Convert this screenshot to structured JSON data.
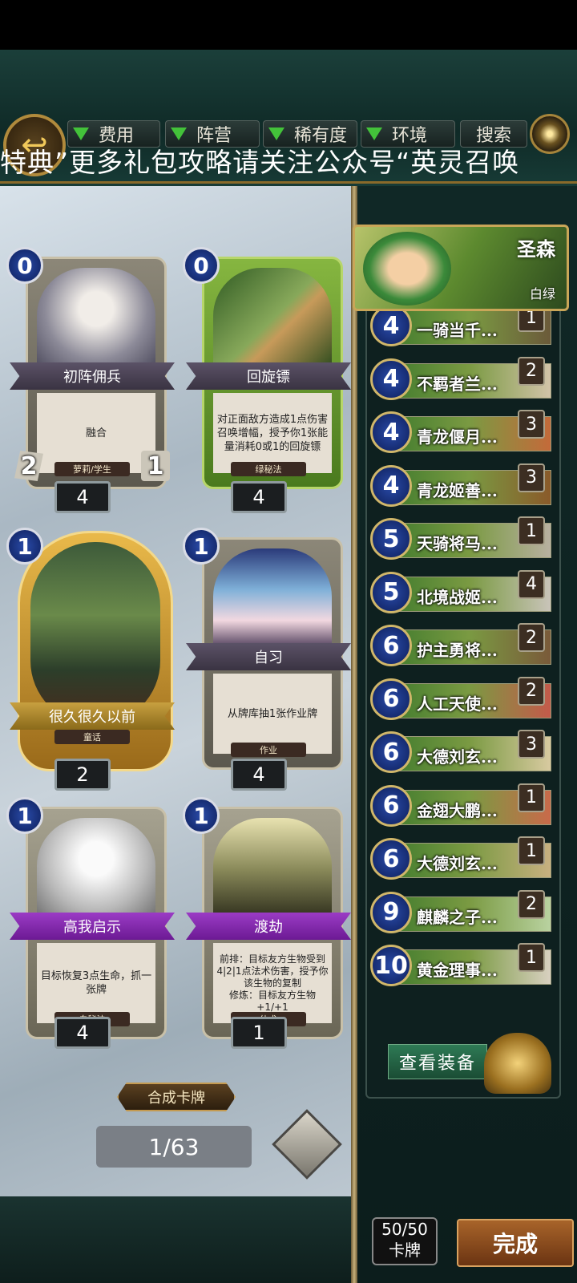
{
  "header": {
    "filters": [
      {
        "label": "费用"
      },
      {
        "label": "阵营"
      },
      {
        "label": "稀有度"
      },
      {
        "label": "环境"
      }
    ],
    "search_label": "搜索",
    "marquee": "特典”更多礼包攻略请关注公众号“英灵召唤"
  },
  "cards": [
    {
      "cost": "0",
      "name": "初阵佣兵",
      "text": "融合",
      "tag": "萝莉/学生",
      "attack": "2",
      "health": "1",
      "count": "4",
      "frame": "gray"
    },
    {
      "cost": "0",
      "name": "回旋镖",
      "text": "对正面敌方造成1点伤害\n召唤增幅，授予你1张能量消耗0或1的回旋镖",
      "tag": "绿秘法",
      "count": "4",
      "frame": "green"
    },
    {
      "cost": "1",
      "name": "很久很久以前",
      "text": "",
      "tag": "童话",
      "count": "2",
      "frame": "gold"
    },
    {
      "cost": "1",
      "name": "自习",
      "text": "从牌库抽1张作业牌",
      "tag": "作业",
      "count": "4",
      "frame": "gray"
    },
    {
      "cost": "1",
      "name": "高我启示",
      "text": "目标恢复3点生命，抓一张牌",
      "tag": "白秘法",
      "count": "4",
      "frame": "purple"
    },
    {
      "cost": "1",
      "name": "渡劫",
      "text": "前排：目标友方生物受到4|2|1点法术伤害，授予你该生物的复制\n修炼：目标友方生物+1/+1",
      "tag": "仙术",
      "count": "1",
      "frame": "purple"
    }
  ],
  "synth_label": "合成卡牌",
  "pagination": "1/63",
  "hero": {
    "name": "圣森",
    "faction": "白绿"
  },
  "deck": [
    {
      "cost": "4",
      "name": "一骑当千...",
      "count": "1"
    },
    {
      "cost": "4",
      "name": "不羁者兰...",
      "count": "2"
    },
    {
      "cost": "4",
      "name": "青龙偃月...",
      "count": "3"
    },
    {
      "cost": "4",
      "name": "青龙姬善...",
      "count": "3"
    },
    {
      "cost": "5",
      "name": "天骑将马...",
      "count": "1"
    },
    {
      "cost": "5",
      "name": "北境战姬...",
      "count": "4"
    },
    {
      "cost": "6",
      "name": "护主勇将...",
      "count": "2"
    },
    {
      "cost": "6",
      "name": "人工天使...",
      "count": "2"
    },
    {
      "cost": "6",
      "name": "大德刘玄...",
      "count": "3"
    },
    {
      "cost": "6",
      "name": "金翅大鹏...",
      "count": "1"
    },
    {
      "cost": "6",
      "name": "大德刘玄...",
      "count": "1"
    },
    {
      "cost": "9",
      "name": "麒麟之子...",
      "count": "2"
    },
    {
      "cost": "10",
      "name": "黄金理事...",
      "count": "1"
    }
  ],
  "equip_label": "查看装备",
  "deck_count": {
    "value": "50/50",
    "label": "卡牌"
  },
  "done_label": "完成"
}
